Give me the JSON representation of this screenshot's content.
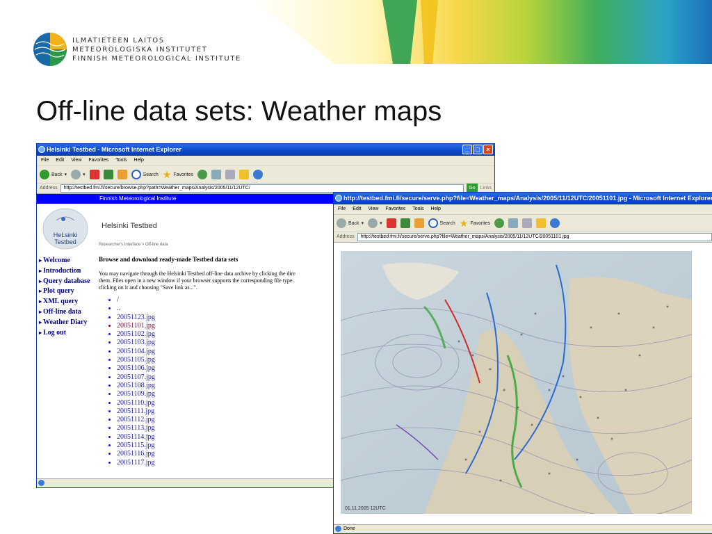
{
  "colors": {
    "title_text": "#111111",
    "ie_title": "#0a47c7",
    "fmi_bar": "#0000ff",
    "link": "#1a1aa6",
    "visited_link": "#800040"
  },
  "header": {
    "org_lines": [
      "ILMATIETEEN LAITOS",
      "METEOROLOGISKA INSTITUTET",
      "FINNISH METEOROLOGICAL INSTITUTE"
    ],
    "slide_title": "Off-line data sets: Weather maps"
  },
  "browser1": {
    "title": "Helsinki Testbed - Microsoft Internet Explorer",
    "menu": [
      "File",
      "Edit",
      "View",
      "Favorites",
      "Tools",
      "Help"
    ],
    "toolbar": {
      "back": "Back",
      "search": "Search",
      "favorites": "Favorites"
    },
    "address_label": "Address",
    "address": "http://testbed.fmi.fi/secure/browse.php?path=Weather_maps/Analysis/2005/11/12UTC/",
    "go": "Go",
    "links": "Links",
    "page": {
      "banner": "Finnish Meteorological Institute",
      "logo_text_1": "HeLsinki",
      "logo_text_2": "Testbed",
      "site_name": "Helsinki Testbed",
      "breadcrumb": "Researcher's Interface > Off-line data",
      "nav": [
        "Welcome",
        "Introduction",
        "Query database",
        "Plot query",
        "XML query",
        "Off-line data",
        "Weather Diary",
        "Log out"
      ],
      "heading": "Browse and download ready-made Testbed data sets",
      "paragraph_lines": [
        "You may navigate through the Helsinki Testbed off-line data archive by clicking the dire",
        "them. Files open in a new window if your browser supports the corresponding file type.",
        "clicking on it and choosing \"Save link as...\"."
      ],
      "files": [
        "/",
        "..",
        "20051123.jpg",
        "20051101.jpg",
        "20051102.jpg",
        "20051103.jpg",
        "20051104.jpg",
        "20051105.jpg",
        "20051106.jpg",
        "20051107.jpg",
        "20051108.jpg",
        "20051109.jpg",
        "20051110.jpg",
        "20051111.jpg",
        "20051112.jpg",
        "20051113.jpg",
        "20051114.jpg",
        "20051115.jpg",
        "20051116.jpg",
        "20051117.jpg"
      ]
    }
  },
  "browser2": {
    "title": "http://testbed.fmi.fi/secure/serve.php?file=Weather_maps/Analysis/2005/11/12UTC/20051101.jpg - Microsoft Internet Explorer",
    "menu": [
      "File",
      "Edit",
      "View",
      "Favorites",
      "Tools",
      "Help"
    ],
    "toolbar": {
      "back": "Back",
      "search": "Search",
      "favorites": "Favorites"
    },
    "address_label": "Address",
    "address": "http://testbed.fmi.fi/secure/serve.php?file=Weather_maps/Analysis/2005/11/12UTC/20051101.jpg",
    "map_stamp": "01.11.2005 12UTC",
    "status": "Done"
  }
}
